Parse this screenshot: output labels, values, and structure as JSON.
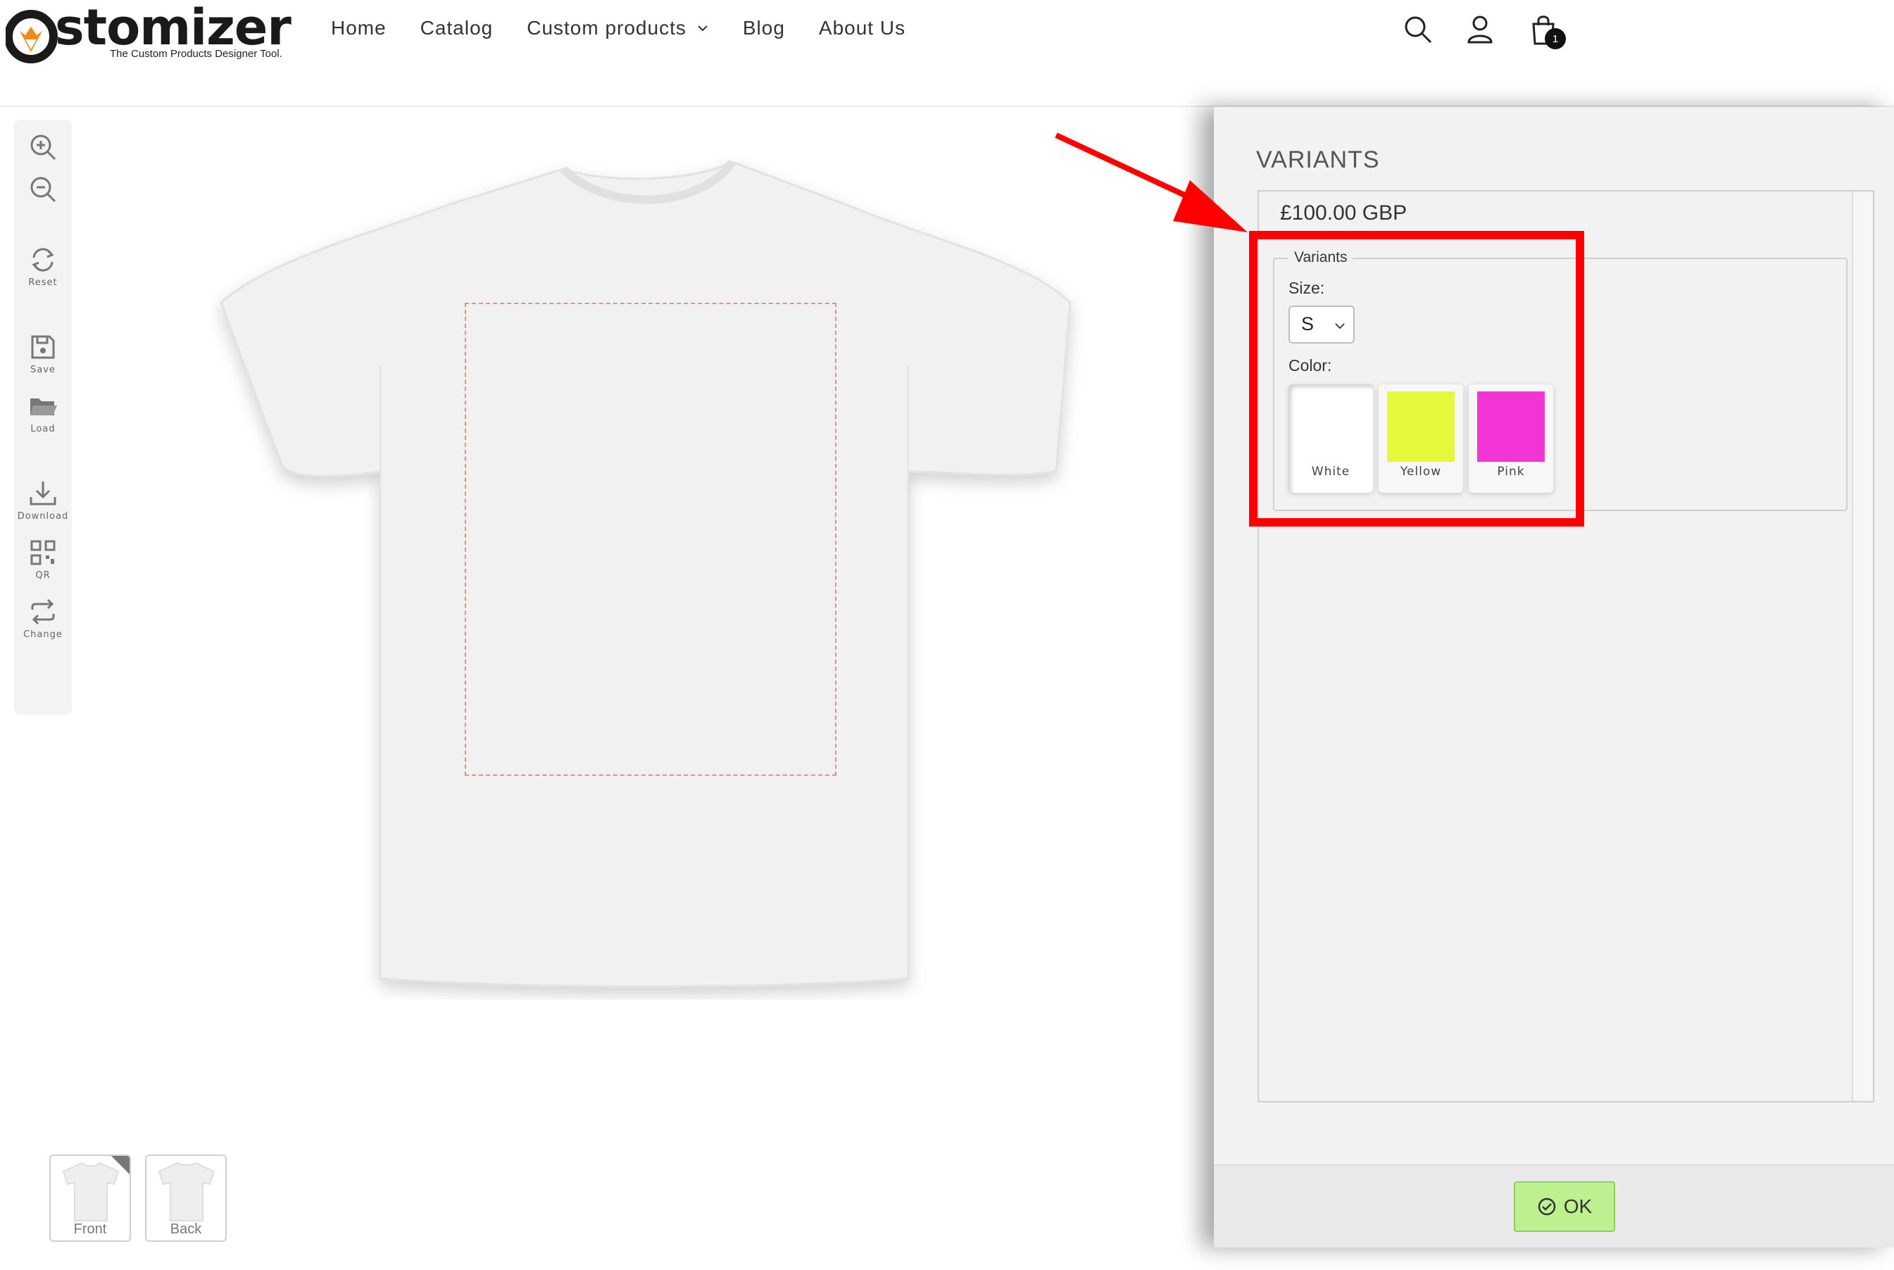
{
  "logo": {
    "mark": "fox-mark-icon",
    "text": "stomizer",
    "tagline": "The Custom Products Designer Tool."
  },
  "nav": {
    "items": [
      "Home",
      "Catalog",
      "Custom products",
      "Blog",
      "About Us"
    ]
  },
  "header_icons": {
    "search": "search-icon",
    "account": "user-icon",
    "cart": "cart-icon",
    "cart_count": "1"
  },
  "toolbar": {
    "tools": [
      {
        "icon": "zoom-in-icon",
        "label": ""
      },
      {
        "icon": "zoom-out-icon",
        "label": ""
      },
      {
        "icon": "reset-icon",
        "label": "Reset"
      },
      {
        "icon": "save-icon",
        "label": "Save"
      },
      {
        "icon": "folder-icon",
        "label": "Load"
      },
      {
        "icon": "download-icon",
        "label": "Download"
      },
      {
        "icon": "qr-icon",
        "label": "QR"
      },
      {
        "icon": "change-icon",
        "label": "Change"
      }
    ]
  },
  "canvas": {
    "product_color": "#f1f1f1",
    "print_area_border_color": "#f08a8a"
  },
  "views": [
    {
      "label": "Front",
      "active": true
    },
    {
      "label": "Back",
      "active": false
    }
  ],
  "panel": {
    "title": "VARIANTS",
    "price": "£100.00 GBP",
    "fieldset_legend": "Variants",
    "size_label": "Size:",
    "size_value": "S",
    "color_label": "Color:",
    "colors": [
      {
        "name": "White",
        "hex": "#ffffff",
        "selected": true
      },
      {
        "name": "Yellow",
        "hex": "#e6f83a",
        "selected": false
      },
      {
        "name": "Pink",
        "hex": "#f335d6",
        "selected": false
      }
    ],
    "ok_label": "OK"
  },
  "annotation": {
    "color": "#ff0000"
  }
}
